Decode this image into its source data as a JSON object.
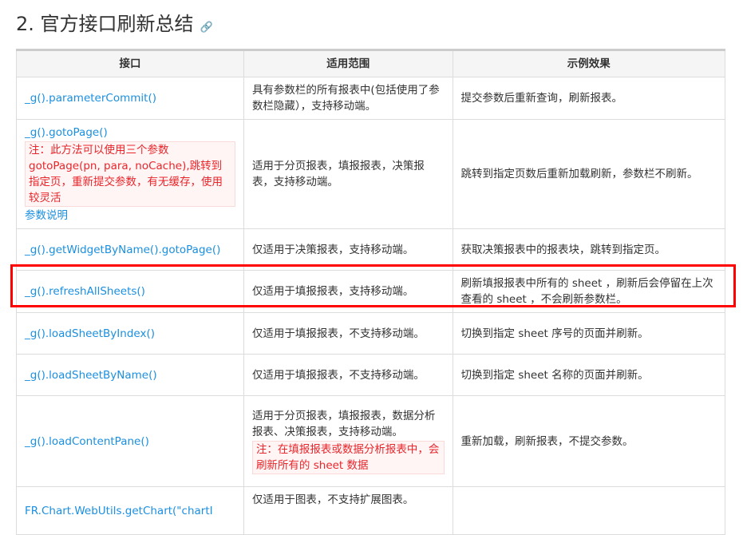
{
  "heading": {
    "title": "2. 官方接口刷新总结",
    "anchor_icon": "link-icon"
  },
  "table": {
    "headers": [
      "接口",
      "适用范围",
      "示例效果"
    ],
    "rows": [
      {
        "api": "_g().parameterCommit()",
        "scope": "具有参数栏的所有报表中(包括使用了参数栏隐藏），支持移动端。",
        "effect": "提交参数后重新查询，刷新报表。"
      },
      {
        "api": "_g().gotoPage()",
        "api_note": "注：此方法可以使用三个参数 gotoPage(pn, para, noCache),跳转到指定页，重新提交参数，有无缓存，使用较灵活",
        "api_link": "参数说明",
        "scope": "适用于分页报表，填报报表，决策报表，支持移动端。",
        "effect": "跳转到指定页数后重新加载刷新，参数栏不刷新。"
      },
      {
        "api": "_g().getWidgetByName().gotoPage()",
        "scope": "仅适用于决策报表，支持移动端。",
        "effect": "获取决策报表中的报表块，跳转到指定页。"
      },
      {
        "api": "_g().refreshAllSheets()",
        "scope": "仅适用于填报报表，支持移动端。",
        "effect": "刷新填报报表中所有的 sheet ，刷新后会停留在上次查看的 sheet ，不会刷新参数栏。"
      },
      {
        "api": "_g().loadSheetByIndex()",
        "scope": "仅适用于填报报表，不支持移动端。",
        "effect": "切换到指定 sheet 序号的页面并刷新。"
      },
      {
        "api": "_g().loadSheetByName()",
        "scope": "仅适用于填报报表，不支持移动端。",
        "effect": "切换到指定 sheet 名称的页面并刷新。"
      },
      {
        "api": "_g().loadContentPane()",
        "scope": "适用于分页报表，填报报表，数据分析报表、决策报表，支持移动端。",
        "scope_note": "注：在填报报表或数据分析报表中，会刷新所有的 sheet 数据",
        "effect": "重新加载，刷新报表，不提交参数。"
      },
      {
        "api": "FR.Chart.WebUtils.getChart(\"chartI",
        "scope": "仅适用于图表，不支持扩展图表。",
        "effect": ""
      }
    ]
  }
}
